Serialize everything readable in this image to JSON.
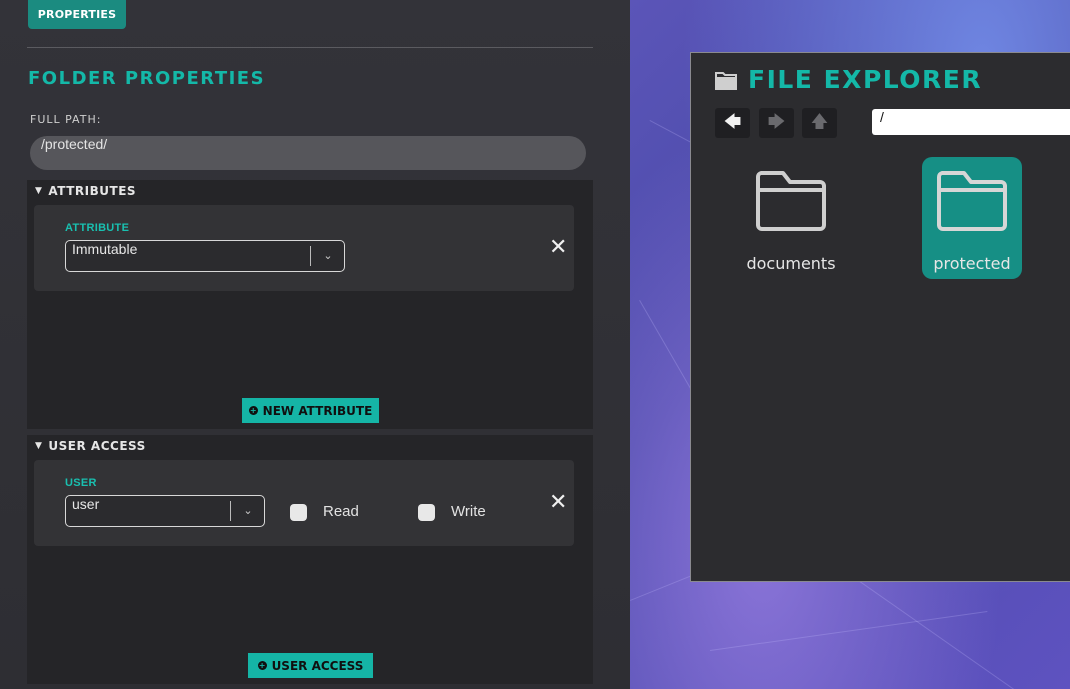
{
  "properties_panel": {
    "tab_label": "PROPERTIES",
    "title": "FOLDER PROPERTIES",
    "full_path_label": "FULL PATH:",
    "full_path_value": "/protected/",
    "attributes_section": {
      "header": "ATTRIBUTES",
      "field_label": "ATTRIBUTE",
      "selected_value": "Immutable",
      "add_button_label": "NEW ATTRIBUTE"
    },
    "user_access_section": {
      "header": "USER ACCESS",
      "field_label": "USER",
      "selected_value": "user",
      "read_label": "Read",
      "read_checked": false,
      "write_label": "Write",
      "write_checked": false,
      "add_button_label": "USER ACCESS"
    }
  },
  "file_explorer": {
    "title": "FILE EXPLORER",
    "address_value": "/",
    "nav_icons": [
      "arrow-left-icon",
      "arrow-right-icon",
      "arrow-up-icon"
    ],
    "items": [
      {
        "name": "documents",
        "selected": false
      },
      {
        "name": "protected",
        "selected": true
      }
    ]
  },
  "colors": {
    "accent": "#14b8a8",
    "button_teal": "#15b5a6",
    "selected_folder_bg": "#168f85",
    "panel_bg": "#2e2e33"
  }
}
